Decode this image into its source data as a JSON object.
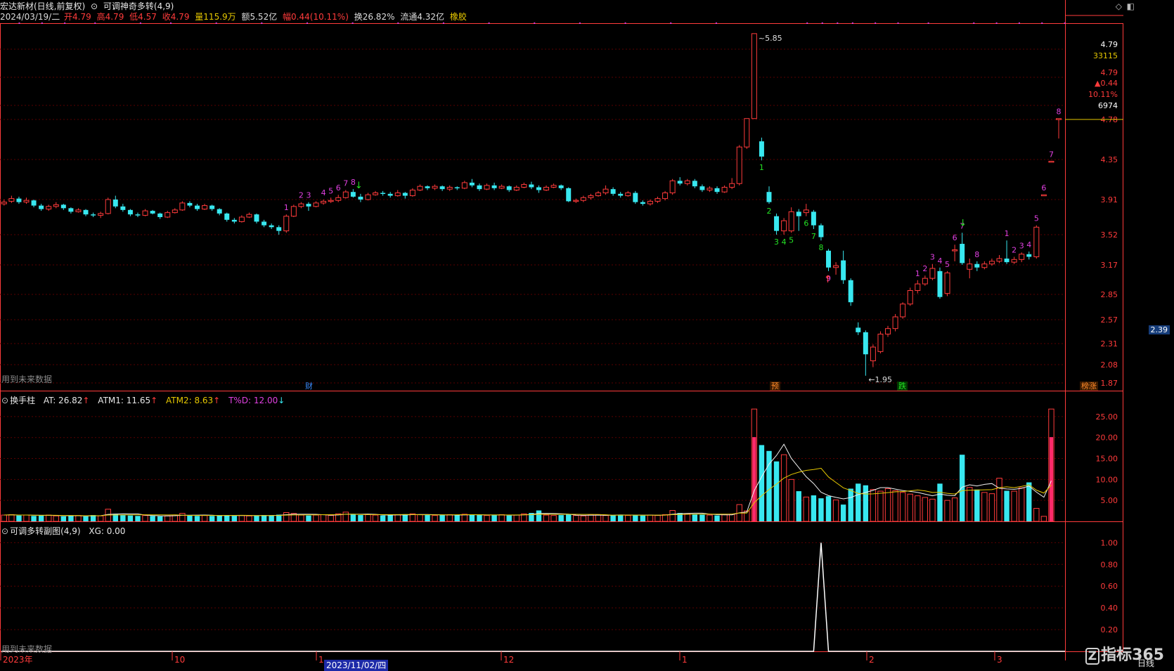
{
  "header": {
    "stock": "宏达新材(日线,前复权)",
    "indicator": "可调神奇多转(4,9)",
    "date": "2024/03/19/二",
    "open": "开4.79",
    "high": "高4.79",
    "low": "低4.57",
    "close": "收4.79",
    "volume": "量115.9万",
    "amount": "额5.52亿",
    "change": "幅0.44(10.11%)",
    "turnover": "换26.82%",
    "float": "流通4.32亿",
    "sector": "橡胶"
  },
  "colors": {
    "up": "#ff3b3b",
    "down": "#38e8f0",
    "grid": "#5a0000",
    "magenta": "#e040e0",
    "green": "#24e024",
    "yellow": "#e6c800",
    "white": "#e8e8e8",
    "axis": "#ff3b3b"
  },
  "price_axis": {
    "ticks": [
      "4.78",
      "4.35",
      "3.91",
      "3.52",
      "3.17",
      "2.85",
      "2.57",
      "2.31",
      "2.08",
      "1.87"
    ],
    "mark": "2.39",
    "extra": [
      "4.79",
      "33115",
      "4.79",
      "▲0.44",
      "10.11%",
      "6974"
    ]
  },
  "markers": {
    "high_label": "5.85",
    "low_label": "1.95",
    "note_top": "用到未来数据",
    "note_bottom": "用到未来数据"
  },
  "event_tags": [
    {
      "label": "财",
      "color": "#3a8cff"
    },
    {
      "label": "预",
      "color": "#ff8a2a"
    },
    {
      "label": "跌",
      "color": "#24e024"
    },
    {
      "label": "榜涨",
      "color": "#ff8a2a"
    }
  ],
  "vol_panel": {
    "name": "换手柱",
    "at": "AT: 26.82",
    "atm1": "ATM1: 11.65",
    "atm2": "ATM2: 8.63",
    "td": "T%D: 12.00",
    "ticks": [
      "25.00",
      "20.00",
      "15.00",
      "10.00",
      "5.00"
    ]
  },
  "sub_panel": {
    "name": "可调多转副图(4,9)",
    "xg": "XG: 0.00",
    "ticks": [
      "1.00",
      "0.80",
      "0.60",
      "0.40",
      "0.20"
    ]
  },
  "time_axis": {
    "labels": [
      "2023年",
      "10",
      "1",
      "12",
      "1",
      "2",
      "3"
    ],
    "selected_date": "2023/11/02/四",
    "period": "日线"
  },
  "watermark": "指标365",
  "chart_data": {
    "type": "candlestick",
    "title": "可调神奇多转(4,9)",
    "ylim": [
      1.85,
      5.9
    ],
    "high": 5.85,
    "low": 1.95,
    "candles": [
      [
        3.86,
        3.88,
        3.91,
        3.84
      ],
      [
        3.89,
        3.92,
        3.95,
        3.87
      ],
      [
        3.92,
        3.88,
        3.94,
        3.86
      ],
      [
        3.88,
        3.9,
        3.93,
        3.86
      ],
      [
        3.9,
        3.84,
        3.91,
        3.82
      ],
      [
        3.84,
        3.8,
        3.86,
        3.78
      ],
      [
        3.8,
        3.83,
        3.85,
        3.78
      ],
      [
        3.83,
        3.85,
        3.88,
        3.81
      ],
      [
        3.85,
        3.81,
        3.86,
        3.79
      ],
      [
        3.81,
        3.77,
        3.82,
        3.75
      ],
      [
        3.77,
        3.79,
        3.81,
        3.76
      ],
      [
        3.79,
        3.74,
        3.8,
        3.72
      ],
      [
        3.74,
        3.73,
        3.76,
        3.71
      ],
      [
        3.73,
        3.75,
        3.77,
        3.7
      ],
      [
        3.75,
        3.91,
        3.93,
        3.74
      ],
      [
        3.91,
        3.83,
        3.95,
        3.81
      ],
      [
        3.83,
        3.79,
        3.86,
        3.77
      ],
      [
        3.79,
        3.74,
        3.8,
        3.72
      ],
      [
        3.74,
        3.73,
        3.76,
        3.71
      ],
      [
        3.73,
        3.78,
        3.8,
        3.72
      ],
      [
        3.78,
        3.75,
        3.79,
        3.74
      ],
      [
        3.75,
        3.71,
        3.76,
        3.69
      ],
      [
        3.71,
        3.76,
        3.78,
        3.7
      ],
      [
        3.76,
        3.79,
        3.81,
        3.75
      ],
      [
        3.79,
        3.87,
        3.89,
        3.78
      ],
      [
        3.87,
        3.84,
        3.89,
        3.82
      ],
      [
        3.84,
        3.8,
        3.86,
        3.78
      ],
      [
        3.8,
        3.84,
        3.86,
        3.79
      ],
      [
        3.84,
        3.8,
        3.85,
        3.78
      ],
      [
        3.8,
        3.75,
        3.81,
        3.73
      ],
      [
        3.75,
        3.68,
        3.76,
        3.66
      ],
      [
        3.68,
        3.66,
        3.7,
        3.64
      ],
      [
        3.66,
        3.71,
        3.73,
        3.65
      ],
      [
        3.71,
        3.74,
        3.76,
        3.7
      ],
      [
        3.74,
        3.66,
        3.75,
        3.64
      ],
      [
        3.66,
        3.62,
        3.68,
        3.6
      ],
      [
        3.62,
        3.6,
        3.64,
        3.58
      ],
      [
        3.6,
        3.56,
        3.62,
        3.52
      ],
      [
        3.56,
        3.72,
        3.74,
        3.54
      ],
      [
        3.72,
        3.83,
        3.85,
        3.71
      ],
      [
        3.83,
        3.86,
        3.88,
        3.81
      ],
      [
        3.86,
        3.83,
        3.88,
        3.78
      ],
      [
        3.83,
        3.87,
        3.89,
        3.82
      ],
      [
        3.87,
        3.89,
        3.91,
        3.85
      ],
      [
        3.89,
        3.9,
        3.93,
        3.87
      ],
      [
        3.9,
        3.93,
        3.96,
        3.88
      ],
      [
        3.93,
        3.99,
        4.01,
        3.92
      ],
      [
        3.99,
        3.94,
        4.02,
        3.93
      ],
      [
        3.94,
        3.91,
        3.97,
        3.88
      ],
      [
        3.91,
        3.96,
        3.98,
        3.9
      ],
      [
        3.96,
        3.98,
        4.0,
        3.95
      ],
      [
        3.98,
        3.97,
        4.0,
        3.95
      ],
      [
        3.97,
        3.95,
        3.99,
        3.93
      ],
      [
        3.95,
        3.98,
        4.01,
        3.94
      ],
      [
        3.98,
        3.95,
        3.99,
        3.92
      ],
      [
        3.95,
        4.01,
        4.03,
        3.94
      ],
      [
        4.01,
        4.05,
        4.07,
        4.0
      ],
      [
        4.05,
        4.03,
        4.06,
        4.01
      ],
      [
        4.03,
        4.05,
        4.07,
        4.01
      ],
      [
        4.05,
        4.02,
        4.06,
        4.0
      ],
      [
        4.02,
        4.04,
        4.06,
        4.0
      ],
      [
        4.04,
        4.03,
        4.05,
        4.01
      ],
      [
        4.03,
        4.09,
        4.11,
        4.02
      ],
      [
        4.09,
        4.06,
        4.13,
        4.04
      ],
      [
        4.06,
        4.02,
        4.08,
        4.0
      ],
      [
        4.02,
        4.06,
        4.08,
        4.01
      ],
      [
        4.06,
        4.03,
        4.09,
        4.01
      ],
      [
        4.03,
        4.05,
        4.07,
        4.02
      ],
      [
        4.05,
        4.01,
        4.06,
        3.99
      ],
      [
        4.01,
        4.04,
        4.06,
        4.0
      ],
      [
        4.04,
        4.07,
        4.09,
        4.03
      ],
      [
        4.07,
        4.04,
        4.1,
        4.02
      ],
      [
        4.04,
        4.01,
        4.06,
        3.98
      ],
      [
        4.01,
        4.04,
        4.06,
        4.0
      ],
      [
        4.04,
        4.06,
        4.08,
        4.03
      ],
      [
        4.06,
        4.03,
        4.07,
        4.01
      ],
      [
        4.03,
        3.89,
        4.04,
        3.88
      ],
      [
        3.89,
        3.9,
        3.92,
        3.87
      ],
      [
        3.9,
        3.93,
        3.95,
        3.88
      ],
      [
        3.93,
        3.95,
        3.97,
        3.91
      ],
      [
        3.95,
        3.98,
        4.0,
        3.94
      ],
      [
        3.98,
        4.02,
        4.06,
        3.96
      ],
      [
        4.02,
        3.97,
        4.04,
        3.95
      ],
      [
        3.97,
        3.95,
        3.99,
        3.93
      ],
      [
        3.95,
        3.98,
        4.0,
        3.94
      ],
      [
        3.98,
        3.88,
        4.0,
        3.86
      ],
      [
        3.88,
        3.86,
        3.9,
        3.84
      ],
      [
        3.86,
        3.89,
        3.91,
        3.84
      ],
      [
        3.89,
        3.92,
        3.94,
        3.87
      ],
      [
        3.92,
        3.98,
        4.0,
        3.9
      ],
      [
        3.98,
        4.11,
        4.13,
        3.96
      ],
      [
        4.11,
        4.08,
        4.15,
        4.06
      ],
      [
        4.08,
        4.11,
        4.13,
        4.06
      ],
      [
        4.11,
        4.05,
        4.13,
        4.03
      ],
      [
        4.05,
        4.01,
        4.07,
        3.99
      ],
      [
        4.01,
        4.03,
        4.05,
        3.99
      ],
      [
        4.03,
        3.99,
        4.05,
        3.97
      ],
      [
        3.99,
        4.04,
        4.06,
        3.98
      ],
      [
        4.04,
        4.08,
        4.14,
        4.02
      ],
      [
        4.08,
        4.48,
        4.5,
        4.06
      ],
      [
        4.48,
        4.79,
        4.79,
        4.46
      ],
      [
        4.79,
        5.85,
        5.85,
        4.79
      ],
      [
        4.54,
        4.38,
        4.58,
        4.34
      ],
      [
        3.99,
        3.88,
        4.05,
        3.86
      ],
      [
        3.72,
        3.56,
        3.75,
        3.52
      ],
      [
        3.56,
        3.67,
        3.7,
        3.52
      ],
      [
        3.56,
        3.77,
        3.82,
        3.54
      ],
      [
        3.77,
        3.72,
        3.8,
        3.56
      ],
      [
        3.76,
        3.79,
        3.86,
        3.72
      ],
      [
        3.77,
        3.62,
        3.79,
        3.58
      ],
      [
        3.62,
        3.49,
        3.64,
        3.45
      ],
      [
        3.33,
        3.14,
        3.35,
        3.1
      ],
      [
        3.14,
        3.16,
        3.2,
        3.06
      ],
      [
        3.22,
        3.0,
        3.33,
        2.96
      ],
      [
        3.0,
        2.76,
        3.02,
        2.72
      ],
      [
        2.48,
        2.43,
        2.54,
        2.4
      ],
      [
        2.43,
        2.19,
        2.45,
        1.95
      ],
      [
        2.12,
        2.27,
        2.3,
        2.05
      ],
      [
        2.22,
        2.41,
        2.44,
        2.2
      ],
      [
        2.41,
        2.47,
        2.5,
        2.38
      ],
      [
        2.47,
        2.6,
        2.63,
        2.44
      ],
      [
        2.6,
        2.74,
        2.76,
        2.58
      ],
      [
        2.74,
        2.89,
        2.92,
        2.72
      ],
      [
        2.89,
        2.96,
        3.0,
        2.86
      ],
      [
        2.96,
        3.02,
        3.05,
        2.94
      ],
      [
        3.02,
        3.13,
        3.18,
        3.0
      ],
      [
        3.1,
        2.82,
        3.14,
        2.8
      ],
      [
        2.86,
        3.08,
        3.1,
        2.83
      ],
      [
        3.33,
        3.34,
        3.4,
        3.21
      ],
      [
        3.41,
        3.19,
        3.54,
        3.17
      ],
      [
        3.12,
        3.18,
        3.24,
        3.02
      ],
      [
        3.18,
        3.14,
        3.21,
        3.1
      ],
      [
        3.14,
        3.18,
        3.21,
        3.12
      ],
      [
        3.18,
        3.21,
        3.24,
        3.16
      ],
      [
        3.21,
        3.24,
        3.28,
        3.19
      ],
      [
        3.24,
        3.2,
        3.45,
        3.18
      ],
      [
        3.2,
        3.23,
        3.26,
        3.18
      ],
      [
        3.23,
        3.29,
        3.31,
        3.2
      ],
      [
        3.29,
        3.26,
        3.32,
        3.23
      ],
      [
        3.26,
        3.6,
        3.62,
        3.24
      ],
      [
        3.96,
        3.96,
        3.96,
        3.96
      ],
      [
        4.33,
        4.33,
        4.33,
        4.33
      ],
      [
        4.79,
        4.79,
        4.79,
        4.57
      ]
    ],
    "turnover": [
      1.5,
      1.6,
      1.4,
      1.5,
      1.3,
      1.4,
      1.5,
      1.3,
      1.2,
      1.3,
      1.4,
      1.2,
      1.5,
      1.3,
      2.9,
      1.8,
      1.5,
      1.4,
      1.3,
      1.4,
      1.3,
      1.2,
      1.3,
      1.5,
      1.9,
      1.4,
      1.3,
      1.4,
      1.3,
      1.4,
      1.5,
      1.3,
      1.4,
      1.3,
      1.4,
      1.5,
      1.4,
      1.6,
      2.1,
      1.9,
      1.5,
      1.4,
      1.5,
      1.6,
      1.4,
      1.8,
      2.2,
      1.6,
      1.5,
      1.6,
      1.5,
      1.4,
      1.5,
      1.6,
      1.7,
      1.8,
      1.6,
      1.5,
      1.4,
      1.5,
      1.6,
      1.5,
      1.7,
      1.6,
      1.5,
      1.4,
      1.5,
      1.6,
      1.4,
      1.5,
      1.8,
      2.0,
      2.6,
      1.5,
      1.4,
      1.5,
      1.6,
      1.4,
      1.3,
      1.5,
      1.6,
      1.4,
      1.5,
      1.6,
      1.4,
      1.5,
      1.4,
      1.5,
      1.4,
      1.6,
      2.6,
      2.0,
      1.8,
      1.7,
      1.6,
      1.5,
      1.4,
      1.6,
      1.7,
      4.0,
      2.5,
      26.8,
      18.2,
      16.8,
      14.3,
      15.9,
      10.0,
      7.2,
      5.8,
      6.2,
      5.5,
      6.0,
      5.1,
      4.0,
      7.8,
      9.0,
      8.6,
      7.6,
      7.2,
      7.8,
      7.3,
      6.9,
      6.5,
      6.1,
      5.7,
      5.3,
      9.0,
      5.0,
      5.6,
      15.9,
      8.1,
      7.6,
      6.9,
      6.6,
      10.3,
      7.3,
      7.2,
      8.0,
      9.3,
      3.1,
      1.2,
      26.8
    ],
    "volume_hl": [
      0,
      0,
      0,
      0,
      0,
      0,
      0,
      0,
      0,
      0,
      0,
      0,
      0,
      0,
      0,
      0,
      0,
      0,
      0,
      0,
      0,
      0,
      0,
      0,
      0,
      0,
      0,
      0,
      0,
      0,
      0,
      0,
      0,
      0,
      0,
      0,
      0,
      0,
      0,
      0,
      0,
      0,
      0,
      0,
      0,
      0,
      0,
      0,
      0,
      0,
      0,
      0,
      0,
      0,
      0,
      0,
      0,
      0,
      0,
      0,
      0,
      0,
      0,
      0,
      0,
      0,
      0,
      0,
      0,
      0,
      0,
      0,
      0,
      0,
      0,
      0,
      0,
      0,
      0,
      0,
      0,
      0,
      0,
      0,
      0,
      0,
      0,
      0,
      0,
      0,
      0,
      0,
      0,
      0,
      0,
      0,
      0,
      0,
      0,
      0,
      0,
      0,
      0,
      0,
      0,
      0,
      0,
      0,
      0,
      0,
      0,
      0,
      0,
      0,
      0,
      0,
      0,
      0,
      0,
      0,
      0,
      0,
      0,
      0,
      0,
      0,
      0,
      0,
      0,
      0,
      0,
      0,
      0,
      0,
      0,
      0,
      0,
      0,
      0,
      0,
      0,
      0,
      0
    ],
    "xg": {
      "peak_index": 110,
      "value": 1.0
    },
    "counts_up": [
      {
        "i": 38,
        "n": "1"
      },
      {
        "i": 40,
        "n": "2"
      },
      {
        "i": 41,
        "n": "3"
      },
      {
        "i": 43,
        "n": "4"
      },
      {
        "i": 44,
        "n": "5"
      },
      {
        "i": 45,
        "n": "6"
      },
      {
        "i": 46,
        "n": "7"
      },
      {
        "i": 47,
        "n": "8"
      },
      {
        "i": 123,
        "n": "1"
      },
      {
        "i": 124,
        "n": "2"
      },
      {
        "i": 125,
        "n": "3"
      },
      {
        "i": 126,
        "n": "4"
      },
      {
        "i": 127,
        "n": "5"
      },
      {
        "i": 128,
        "n": "6"
      },
      {
        "i": 129,
        "n": "7"
      },
      {
        "i": 131,
        "n": "8"
      },
      {
        "i": 135,
        "n": "1"
      },
      {
        "i": 136,
        "n": "2"
      },
      {
        "i": 137,
        "n": "3"
      },
      {
        "i": 138,
        "n": "4"
      },
      {
        "i": 139,
        "n": "5"
      },
      {
        "i": 140,
        "n": "6"
      },
      {
        "i": 141,
        "n": "7"
      },
      {
        "i": 142,
        "n": "8"
      }
    ],
    "counts_down": [
      {
        "i": 102,
        "n": "1"
      },
      {
        "i": 103,
        "n": "2"
      },
      {
        "i": 104,
        "n": "3"
      },
      {
        "i": 105,
        "n": "4"
      },
      {
        "i": 106,
        "n": "5"
      },
      {
        "i": 108,
        "n": "6"
      },
      {
        "i": 109,
        "n": "7"
      },
      {
        "i": 110,
        "n": "8"
      },
      {
        "i": 111,
        "n": "9"
      }
    ]
  }
}
